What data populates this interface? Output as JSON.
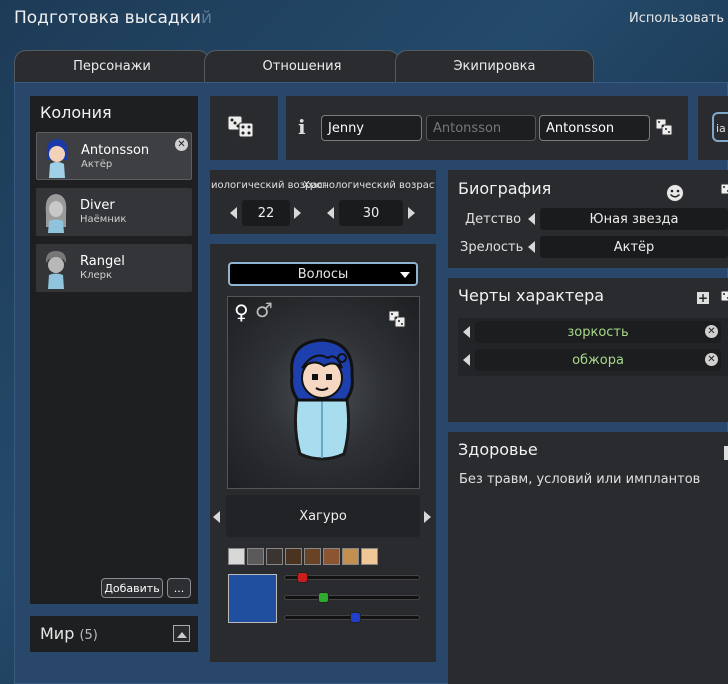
{
  "window": {
    "title": "Подготовка высадки",
    "title_ghost": "й",
    "right_label": "Использовать"
  },
  "tabs": [
    {
      "label": "Персонажи"
    },
    {
      "label": "Отношения"
    },
    {
      "label": "Экипировка"
    }
  ],
  "colony": {
    "title": "Колония",
    "pawns": [
      {
        "name": "Antonsson",
        "role": "Актёр"
      },
      {
        "name": "Diver",
        "role": "Наёмник"
      },
      {
        "name": "Rangel",
        "role": "Клерк"
      }
    ],
    "add_button": "Добавить",
    "more_button": "..."
  },
  "world": {
    "title": "Мир",
    "count": "(5)"
  },
  "name": {
    "first": "Jenny",
    "nick": "Antonsson",
    "last": "Antonsson"
  },
  "age": {
    "bio_label": "иологический возраст",
    "chrono_label": "Хронологический возраст",
    "bio_value": "22",
    "chrono_value": "30"
  },
  "appearance": {
    "dropdown": "Волосы",
    "hairstyle": "Хагуро",
    "swatches": [
      "#d8d8d8",
      "#5a5a5a",
      "#3a3530",
      "#4a3320",
      "#6a4226",
      "#8a5530",
      "#c49050",
      "#f0c898"
    ],
    "selected_color": "#1f4f9e",
    "sliders": [
      {
        "color": "#c81e1e",
        "value": 0.13
      },
      {
        "color": "#2eaa2e",
        "value": 0.29
      },
      {
        "color": "#1f3fcc",
        "value": 0.52
      }
    ]
  },
  "bio": {
    "title": "Биография",
    "childhood_label": "Детство",
    "childhood": "Юная звезда",
    "adulthood_label": "Зрелость",
    "adulthood": "Актёр"
  },
  "traits": {
    "title": "Черты характера",
    "items": [
      "зоркость",
      "обжора"
    ]
  },
  "health": {
    "title": "Здоровье",
    "text": "Без травм, условий или имплантов"
  },
  "icons": {
    "info": "info-icon",
    "dice": "dice-icon",
    "smiley": "smiley-icon",
    "female": "♀",
    "male": "♂"
  }
}
